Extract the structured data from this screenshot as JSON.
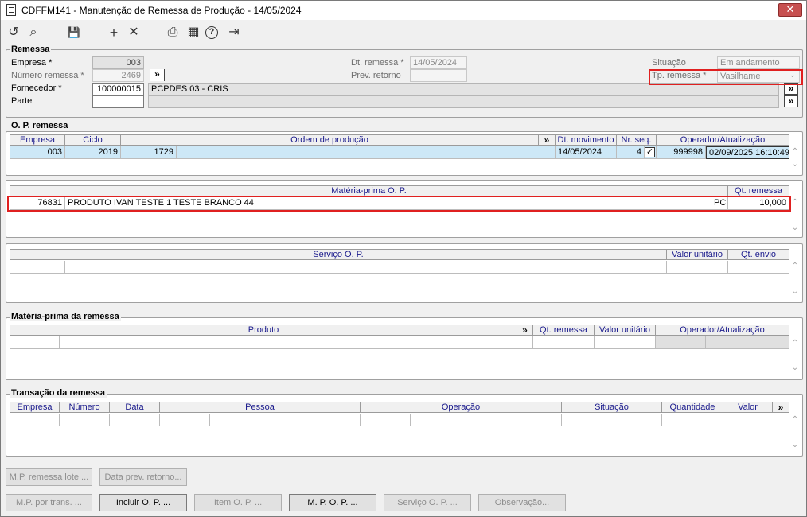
{
  "window": {
    "title": "CDFFM141 - Manutenção de Remessa de Produção - 14/05/2024",
    "close_glyph": "✕"
  },
  "toolbar": {
    "undo_glyph": "↺",
    "search_glyph": "⌕",
    "save_glyph": "💾",
    "add_glyph": "+",
    "delete_glyph": "✕",
    "print_glyph": "⎙",
    "calendar_glyph": "▦",
    "help_glyph": "?",
    "exit_glyph": "⇥"
  },
  "remessa": {
    "title": "Remessa",
    "empresa_label": "Empresa *",
    "empresa_value": "003",
    "numero_label": "Número remessa *",
    "numero_value": "2469",
    "fornecedor_label": "Fornecedor *",
    "fornecedor_code": "100000015",
    "fornecedor_name": "PCPDES 03 - CRIS",
    "parte_label": "Parte",
    "parte_value": "",
    "dt_remessa_label": "Dt. remessa *",
    "dt_remessa_value": "14/05/2024",
    "prev_retorno_label": "Prev. retorno",
    "prev_retorno_value": "",
    "situacao_label": "Situação",
    "situacao_value": "Em andamento",
    "tp_remessa_label": "Tp. remessa *",
    "tp_remessa_value": "Vasilhame",
    "expand_glyph": "»"
  },
  "op_remessa": {
    "title": "O. P. remessa",
    "headers": [
      "Empresa",
      "Ciclo",
      "Ordem de produção",
      "»",
      "Dt. movimento",
      "Nr. seq.",
      "Operador/Atualização"
    ],
    "row": {
      "empresa": "003",
      "ciclo": "2019",
      "ordem": "1729",
      "dt_movimento": "14/05/2024",
      "nr_seq": "4",
      "check": "✓",
      "operador": "999998",
      "atualizacao": "02/09/2025 16:10:49"
    }
  },
  "materia_prima_op": {
    "headers": [
      "Matéria-prima O. P.",
      "Qt. remessa"
    ],
    "row": {
      "codigo": "76831",
      "descricao": "PRODUTO IVAN TESTE 1 TESTE BRANCO 44",
      "unidade": "PC",
      "quantidade": "10,000"
    }
  },
  "servico_op": {
    "headers": [
      "Serviço O. P.",
      "Valor unitário",
      "Qt. envio"
    ]
  },
  "materia_prima_remessa": {
    "title": "Matéria-prima da remessa",
    "headers": [
      "Produto",
      "»",
      "Qt. remessa",
      "Valor unitário",
      "Operador/Atualização"
    ]
  },
  "transacao": {
    "title": "Transação da remessa",
    "headers": [
      "Empresa",
      "Número",
      "Data",
      "Pessoa",
      "Operação",
      "Situação",
      "Quantidade",
      "Valor",
      "»"
    ]
  },
  "buttons": {
    "mp_remessa_lote": "M.P. remessa lote ...",
    "data_prev_retorno": "Data prev. retorno...",
    "mp_por_trans": "M.P. por trans. ...",
    "incluir_op": "Incluir O. P. ...",
    "item_op": "Item O. P. ...",
    "mpop": "M. P. O. P. ...",
    "servico_op": "Serviço O. P. ...",
    "observacao": "Observação..."
  },
  "scroll": {
    "up": "⌃",
    "down": "⌄"
  }
}
